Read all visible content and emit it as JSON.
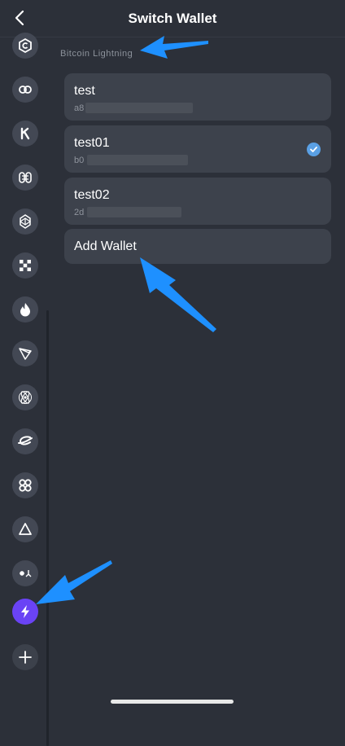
{
  "header": {
    "title": "Switch Wallet",
    "back_icon": "chevron-left-icon"
  },
  "section_label": "Bitcoin Lightning",
  "wallets": [
    {
      "name": "test",
      "address_prefix": "a8",
      "selected": false
    },
    {
      "name": "test01",
      "address_prefix": "b0",
      "selected": true
    },
    {
      "name": "test02",
      "address_prefix": "2d",
      "selected": false
    }
  ],
  "add_wallet_label": "Add Wallet",
  "sidebar_icons": [
    "celo-coin-icon",
    "polygon-link-icon",
    "kucoin-k-icon",
    "hedera-h-icon",
    "fantom-icon",
    "okx-checker-icon",
    "flame-icon",
    "tron-icon",
    "cosmos-atom-icon",
    "swirl-logo-icon",
    "cross-petal-icon",
    "triangle-icon",
    "star-chain-icon",
    "lightning-bolt-icon",
    "plus-icon"
  ],
  "colors": {
    "background": "#2c3039",
    "card": "#3d424c",
    "active_chain": "#6a43f5",
    "check": "#5aa0e4",
    "annotation_arrow": "#1e90ff"
  }
}
